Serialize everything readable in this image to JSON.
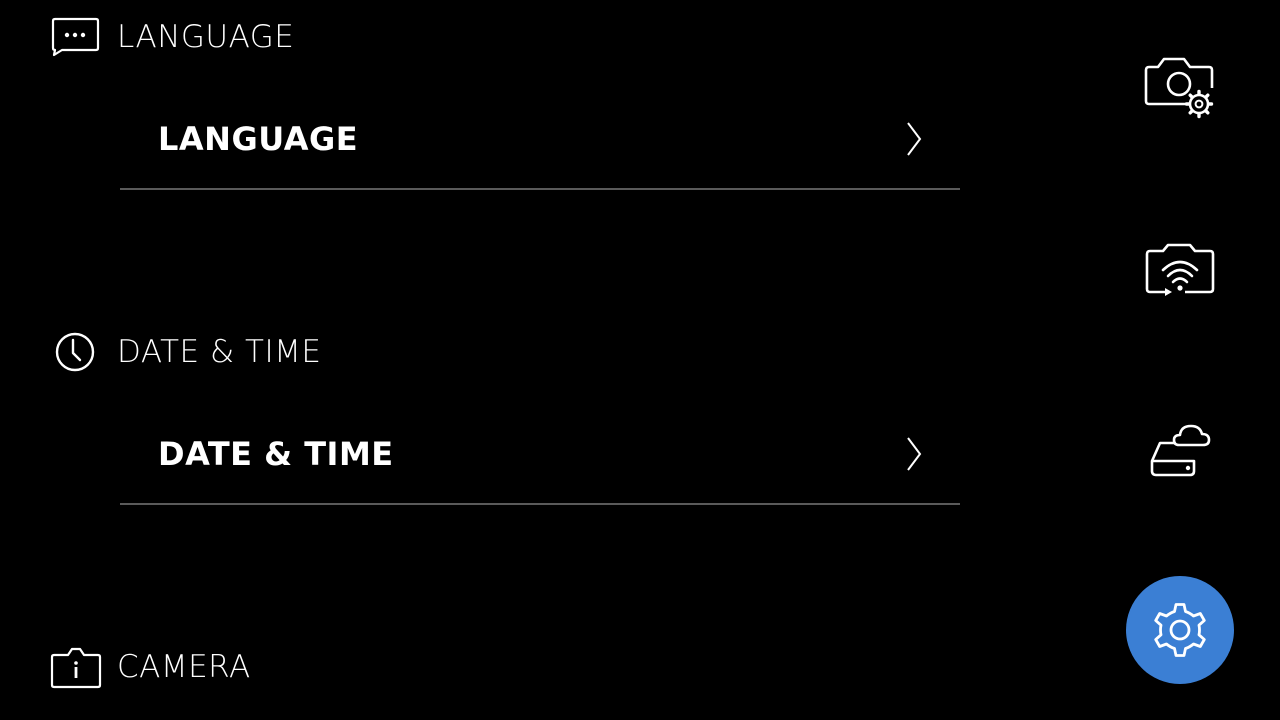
{
  "sections": {
    "language": {
      "header": "LANGUAGE",
      "icon": "speech-bubble-icon",
      "row_label": "LANGUAGE"
    },
    "date_time": {
      "header": "DATE & TIME",
      "icon": "clock-icon",
      "row_label": "DATE & TIME"
    },
    "camera": {
      "header": "CAMERA",
      "icon": "camera-info-icon"
    }
  },
  "nav_rail": {
    "items": [
      {
        "icon": "camera-settings-icon",
        "active": false
      },
      {
        "icon": "camera-wifi-icon",
        "active": false
      },
      {
        "icon": "cloud-storage-icon",
        "active": false
      },
      {
        "icon": "gear-icon",
        "active": true
      }
    ]
  },
  "colors": {
    "background": "#000000",
    "accent": "#3b7fd4",
    "divider": "#5a5a5a",
    "text": "#ffffff"
  }
}
